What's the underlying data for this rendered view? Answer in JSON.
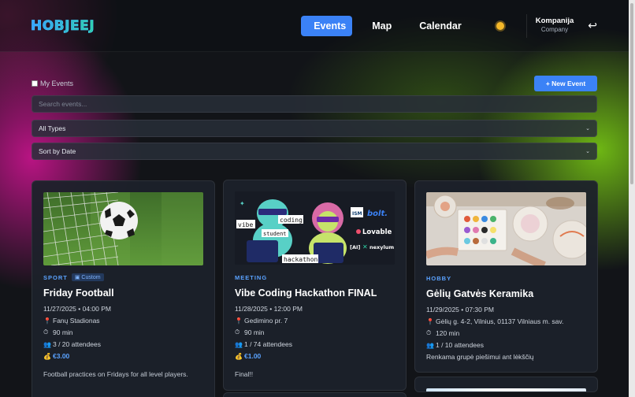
{
  "header": {
    "logo": "HOBJEEJ",
    "nav": [
      "Events",
      "Map",
      "Calendar"
    ],
    "active_nav": "Events",
    "company_name": "Kompanija",
    "company_sub": "Company"
  },
  "controls": {
    "my_events_label": "My Events",
    "new_event_label": "+ New Event",
    "search_placeholder": "Search events...",
    "type_filter": "All Types",
    "sort": "Sort by Date"
  },
  "cards": [
    {
      "category": "SPORT",
      "badge": "Custom",
      "title": "Friday Football",
      "datetime": "11/27/2025 • 04:00 PM",
      "location": "Fanų Stadionas",
      "duration": "90 min",
      "attendees": "3 / 20 attendees",
      "price": "€3.00",
      "description": "Football practices on Fridays for all level players."
    },
    {
      "category": "MEETING",
      "title": "Vibe Coding Hackathon FINAL",
      "datetime": "11/28/2025 • 12:00 PM",
      "location": "Gedimino pr. 7",
      "duration": "90 min",
      "attendees": "1 / 74 attendees",
      "price": "€1.00",
      "description": "Final!!",
      "image_text": {
        "vibe": "vibe",
        "coding": "coding",
        "student": "student",
        "hackathon": "hackathon",
        "ism": "ISM",
        "bolt": "bolt.",
        "lovable": "Lovable",
        "ai": "[AI]",
        "nexylum": "nexylum"
      }
    },
    {
      "category": "HOBBY",
      "title": "Gėlių Gatvės Keramika",
      "datetime": "11/29/2025 • 07:30 PM",
      "location": "Gėlių g. 4-2, Vilnius, 01137 Vilniaus m. sav.",
      "duration": "120 min",
      "attendees": "1 / 10 attendees",
      "description": "Renkama grupė piešimui ant lėkščių"
    }
  ],
  "icons": {
    "location": "map-pin-icon",
    "duration": "stopwatch-icon",
    "attendees": "people-icon",
    "price": "money-bag-icon",
    "theme": "sun-icon",
    "logout": "return-icon"
  },
  "colors": {
    "accent": "#3b82f6",
    "background": "#121418",
    "card": "#1c212a"
  }
}
